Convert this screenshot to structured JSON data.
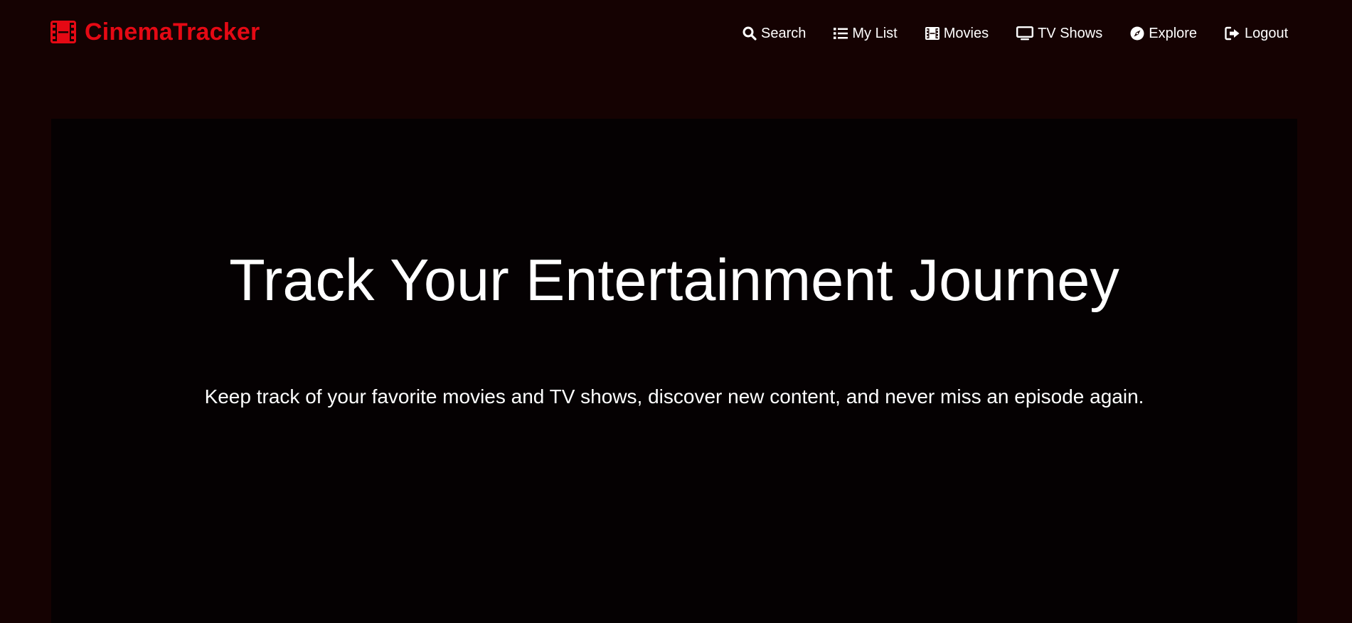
{
  "brand": {
    "name": "CinemaTracker",
    "icon": "film-icon",
    "color": "#e50914"
  },
  "nav": {
    "items": [
      {
        "label": "Search",
        "icon": "search-icon"
      },
      {
        "label": "My List",
        "icon": "list-icon"
      },
      {
        "label": "Movies",
        "icon": "film-icon"
      },
      {
        "label": "TV Shows",
        "icon": "tv-icon"
      },
      {
        "label": "Explore",
        "icon": "compass-icon"
      },
      {
        "label": "Logout",
        "icon": "sign-out-icon"
      }
    ]
  },
  "hero": {
    "title": "Track Your Entertainment Journey",
    "subtitle": "Keep track of your favorite movies and TV shows, discover new content, and never miss an episode again."
  },
  "colors": {
    "page_background": "#150202",
    "hero_background": "#050102",
    "accent": "#e50914",
    "text": "#ffffff"
  }
}
